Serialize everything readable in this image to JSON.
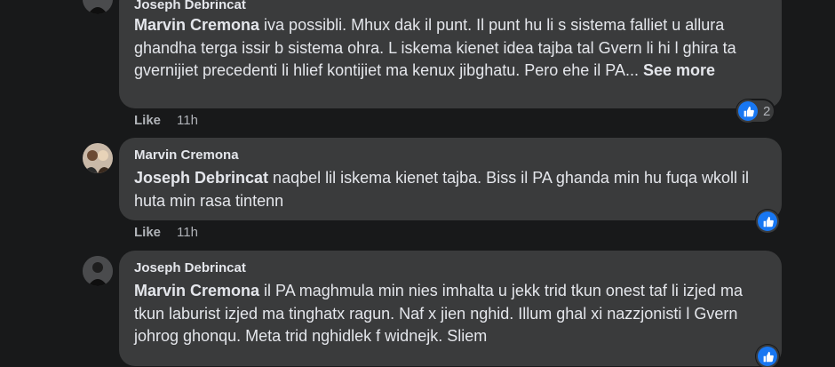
{
  "comments": [
    {
      "author": "Joseph Debrincat",
      "mention": "Marvin Cremona",
      "text": " iva possibli. Mhux dak il punt. Il punt hu li s sistema falliet u allura ghandha terga issir b sistema ohra. L iskema kienet idea tajba tal Gvern li hi l ghira ta gvernijiet precedenti li hlief kontijiet ma kenux jibghatu. Pero ehe il PA...",
      "see_more": "See more",
      "like": "Like",
      "time": "11h",
      "reactions": "2"
    },
    {
      "author": "Marvin Cremona",
      "mention": "Joseph Debrincat",
      "text": " naqbel lil iskema kienet tajba. Biss il PA ghanda min hu fuqa wkoll il huta min rasa tintenn",
      "like": "Like",
      "time": "11h"
    },
    {
      "author": "Joseph Debrincat",
      "mention": "Marvin Cremona",
      "text": " il PA maghmula min nies imhalta u jekk trid tkun onest taf li izjed ma tkun laburist izjed ma tinghatx ragun. Naf x jien nghid. Illum ghal xi nazzjonisti l Gvern johrog ghonqu. Meta trid nghidlek f widnejk. Sliem"
    }
  ]
}
